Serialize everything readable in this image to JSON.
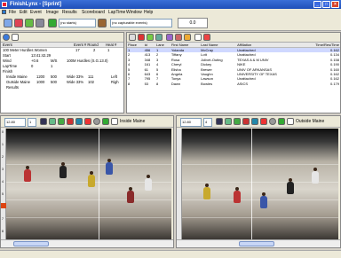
{
  "window": {
    "title": "FinishLynx - [Sprint]"
  },
  "menu": [
    "File",
    "Edit",
    "Event",
    "Image",
    "Results",
    "Scoreboard",
    "LapTime",
    "Window",
    "Help"
  ],
  "toolbar": {
    "starts_label": "(no starts)",
    "capturable_label": "(no capturable events)",
    "time_display": "0.0"
  },
  "event_panel": {
    "header": {
      "col1": "Event",
      "col2": "Event # Round",
      "col3": "Heat #"
    },
    "event_row": {
      "name": "100 Meter Hurdles Women",
      "num": "17",
      "round": "2",
      "heat": "1"
    },
    "start_row": {
      "label": "Start",
      "value": "13:41:42.29"
    },
    "wind_row": {
      "label": "Wind",
      "value": "+0.6",
      "unit": "M/S",
      "event": "100M Hurdles (S.G.13.0)"
    },
    "laptime_row": {
      "label": "LapTime",
      "v1": "0",
      "v2": "1"
    },
    "finish_row": {
      "label": "Finish"
    },
    "cameras": [
      {
        "name": "Inside Maine",
        "v1": "1200",
        "v2": "500",
        "wide": "Wide 33%",
        "n": "111",
        "side": "Left"
      },
      {
        "name": "Outside Maine",
        "v1": "1000",
        "v2": "500",
        "wide": "Wide 33%",
        "n": "102",
        "side": "Righ"
      }
    ],
    "results_label": "Results"
  },
  "results": {
    "columns": [
      "Place",
      "Id",
      "Lane",
      "First Name",
      "Last Name",
      "Affiliation",
      "Time/Res/Time"
    ],
    "rows": [
      {
        "place": "1",
        "id": "456",
        "lane": "1",
        "first": "Yolanda",
        "last": "McCray",
        "aff": "Unattached",
        "time": "0.162"
      },
      {
        "place": "2",
        "id": "413",
        "lane": "2",
        "first": "Tiffany",
        "last": "Lott",
        "aff": "Unattached",
        "time": "0.134"
      },
      {
        "place": "3",
        "id": "348",
        "lane": "3",
        "first": "Rosa",
        "last": "Jolivet-Outing",
        "aff": "TEXAS A & M UNIV",
        "time": "0.158"
      },
      {
        "place": "4",
        "id": "161",
        "lane": "4",
        "first": "Cheryl",
        "last": "Dickey",
        "aff": "NIKE",
        "time": "0.190"
      },
      {
        "place": "5",
        "id": "61",
        "lane": "5",
        "first": "Elisha",
        "last": "Brewer",
        "aff": "UNIV OF ARKANSAS",
        "time": "0.160"
      },
      {
        "place": "6",
        "id": "643",
        "lane": "6",
        "first": "Angela",
        "last": "Vaughn",
        "aff": "UNIVERSITY OF TEXAS",
        "time": "0.162"
      },
      {
        "place": "7",
        "id": "795",
        "lane": "7",
        "first": "Tonya",
        "last": "Lawson",
        "aff": "Unattached",
        "time": "0.162"
      },
      {
        "place": "8",
        "id": "53",
        "lane": "8",
        "first": "Dawn",
        "last": "Bowles",
        "aff": "ASICS",
        "time": "0.179"
      }
    ]
  },
  "viewer_left": {
    "zoom": "12.80",
    "zoom2": "1",
    "camera": "Inside Maine"
  },
  "viewer_right": {
    "zoom": "12.80",
    "zoom2": "4",
    "camera": "Outside Maine"
  },
  "ruler_ticks": [
    "0",
    "1",
    "2",
    "3",
    "4",
    "5",
    "6",
    "7",
    "8"
  ],
  "colors": {
    "title_bar": "#1f4fb8",
    "highlight_row": "#cfd8ff",
    "red_marker": "#d41"
  }
}
